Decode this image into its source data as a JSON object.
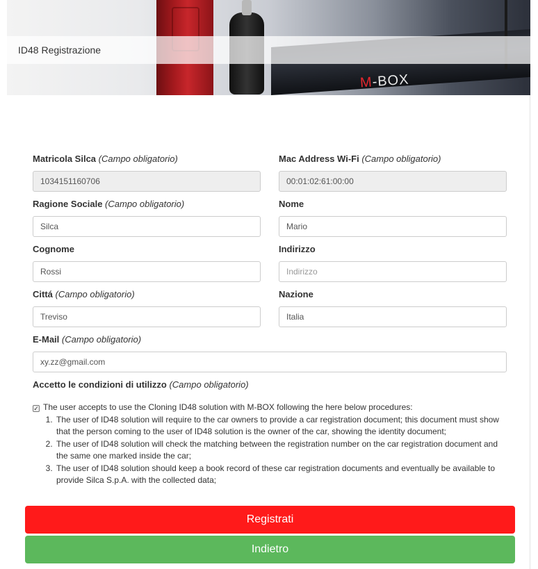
{
  "header": {
    "title": "ID48 Registrazione",
    "banner_brand": "M-BOX"
  },
  "required_suffix": "(Campo obligatorio)",
  "fields": {
    "matricola": {
      "label": "Matricola Silca",
      "required": true,
      "value": "1034151160706",
      "disabled": true
    },
    "mac": {
      "label": "Mac Address Wi-Fi",
      "required": true,
      "value": "00:01:02:61:00:00",
      "disabled": true
    },
    "ragione": {
      "label": "Ragione Sociale",
      "required": true,
      "value": "Silca"
    },
    "nome": {
      "label": "Nome",
      "value": "Mario"
    },
    "cognome": {
      "label": "Cognome",
      "value": "Rossi"
    },
    "indirizzo": {
      "label": "Indirizzo",
      "value": "",
      "placeholder": "Indirizzo"
    },
    "citta": {
      "label": "Cittá",
      "required": true,
      "value": "Treviso"
    },
    "nazione": {
      "label": "Nazione",
      "value": "Italia"
    },
    "email": {
      "label": "E-Mail",
      "required": true,
      "value": "xy.zz@gmail.com"
    }
  },
  "terms": {
    "label": "Accetto le condizioni di utilizzo",
    "checked": true,
    "intro": "The user accepts to use the Cloning ID48 solution with M-BOX following the here below procedures:",
    "items": [
      "The user of ID48 solution will require to the car owners to provide a car registration document; this document must show that the person coming to the user of ID48 solution is the owner of the car, showing the identity document;",
      "The user of ID48 solution will check the matching between the registration number on the car registration document and the same one marked inside the car;",
      "The user of ID48 solution should keep a book record of these car registration documents and eventually be available to provide Silca S.p.A. with the collected data;"
    ]
  },
  "buttons": {
    "register": "Registrati",
    "back": "Indietro"
  },
  "colors": {
    "register_bg": "#ff1a1a",
    "back_bg": "#5cb85c"
  }
}
